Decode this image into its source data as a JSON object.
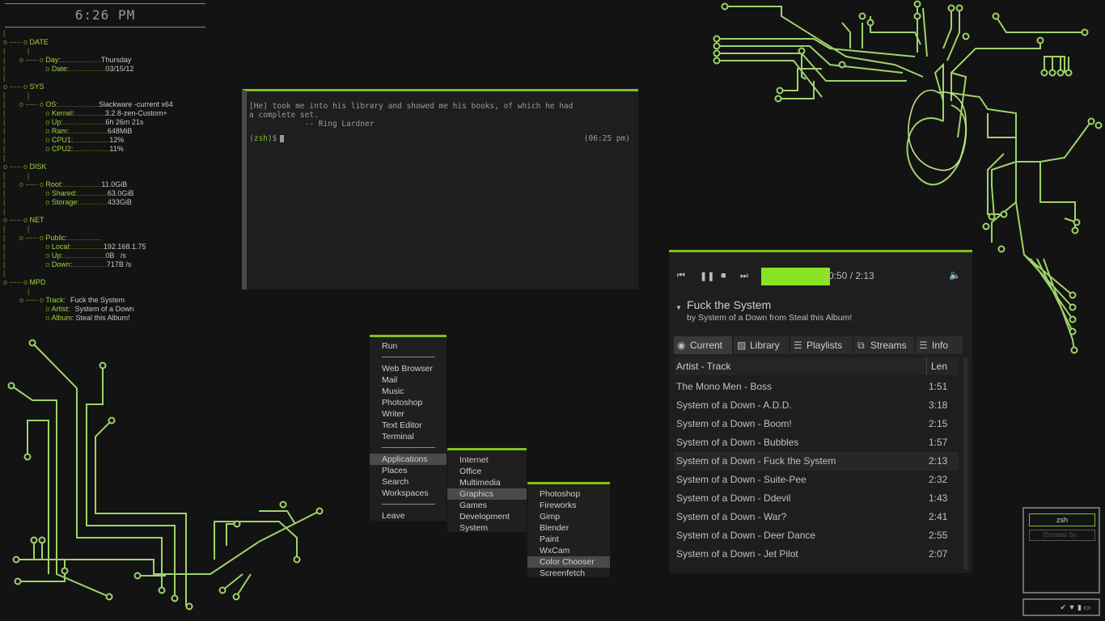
{
  "colors": {
    "accent": "#7ec21c",
    "circuit": "#a8e070",
    "background": "#131313",
    "panel": "#1e1e1e"
  },
  "clock": "6:26 PM",
  "conky": {
    "date": {
      "header": "DATE",
      "day_label": "Day:",
      "day": "Thursday",
      "date_label": "Date:",
      "date": "03/15/12"
    },
    "sys": {
      "header": "SYS",
      "os_label": "OS:",
      "os": "Slackware -current x64",
      "kernel_label": "Kernel:",
      "kernel": "3.2.8-zen-Custom+",
      "up_label": "Up:",
      "up": "6h 26m 21s",
      "ram_label": "Ram:",
      "ram": "648MiB",
      "cpu1_label": "CPU1:",
      "cpu1": "12%",
      "cpu2_label": "CPU2:",
      "cpu2": "11%"
    },
    "disk": {
      "header": "DISK",
      "root_label": "Root:",
      "root": "11.0GiB",
      "shared_label": "Shared:",
      "shared": "63.0GiB",
      "storage_label": "Storage:",
      "storage": "433GiB"
    },
    "net": {
      "header": "NET",
      "public_label": "Public:",
      "public": "",
      "local_label": "Local:",
      "local": "192.168.1.75",
      "up_label": "Up:",
      "up": "0B   /s",
      "down_label": "Down:",
      "down": "717B /s"
    },
    "mpd": {
      "header": "MPD",
      "track_label": "Track:",
      "track": "Fuck the System",
      "artist_label": "Artist:",
      "artist": "System of a Down",
      "album_label": "Album:",
      "album": "Steal this Album!"
    }
  },
  "terminal": {
    "quote_line1": "[He] took me into his library and showed me his books, of which he had",
    "quote_line2": "a complete set.",
    "quote_author": "            -- Ring Lardner",
    "prompt_open": "(",
    "prompt_shell": "zsh",
    "prompt_close": ")$",
    "time": "(06:25 pm)"
  },
  "menu_main": {
    "run": "Run",
    "web_browser": "Web Browser",
    "mail": "Mail",
    "music": "Music",
    "photoshop": "Photoshop",
    "writer": "Writer",
    "text_editor": "Text Editor",
    "terminal": "Terminal",
    "applications": "Applications",
    "places": "Places",
    "search": "Search",
    "workspaces": "Workspaces",
    "leave": "Leave"
  },
  "menu_apps": {
    "internet": "Internet",
    "office": "Office",
    "multimedia": "Multimedia",
    "graphics": "Graphics",
    "games": "Games",
    "development": "Development",
    "system": "System"
  },
  "menu_graphics": {
    "photoshop": "Photoshop",
    "fireworks": "Fireworks",
    "gimp": "Gimp",
    "blender": "Blender",
    "paint": "Paint",
    "wxcam": "WxCam",
    "color_chooser": "Color Chooser",
    "screenfetch": "Screenfetch"
  },
  "player": {
    "time": "0:50 / 2:13",
    "progress": 0.38,
    "track_title": "Fuck the System",
    "track_sub": "by System of a Down from Steal this Album!",
    "tabs": {
      "current": "Current",
      "library": "Library",
      "playlists": "Playlists",
      "streams": "Streams",
      "info": "Info"
    },
    "col_track": "Artist - Track",
    "col_len": "Len",
    "rows": [
      {
        "name": "The Mono Men - Boss",
        "len": "1:51"
      },
      {
        "name": "System of a Down - A.D.D.",
        "len": "3:18"
      },
      {
        "name": "System of a Down - Boom!",
        "len": "2:15"
      },
      {
        "name": "System of a Down - Bubbles",
        "len": "1:57"
      },
      {
        "name": "System of a Down - Fuck the System",
        "len": "2:13"
      },
      {
        "name": "System of a Down - Suite-Pee",
        "len": "2:32"
      },
      {
        "name": "System of a Down - Ddevil",
        "len": "1:43"
      },
      {
        "name": "System of a Down - War?",
        "len": "2:41"
      },
      {
        "name": "System of a Down - Deer Dance",
        "len": "2:55"
      },
      {
        "name": "System of a Down - Jet Pilot",
        "len": "2:07"
      }
    ]
  },
  "pager": {
    "workspace1": "zsh",
    "workspace2": "[Sonata] Sy..."
  }
}
